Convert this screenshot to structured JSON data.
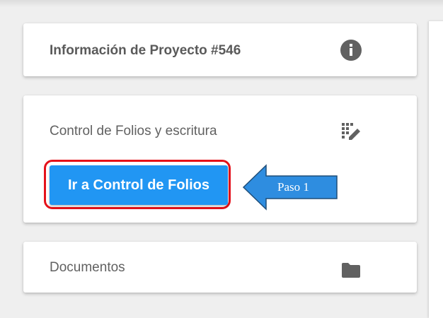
{
  "cards": {
    "info": {
      "title": "Información de Proyecto #546",
      "icon": "info-icon"
    },
    "folios": {
      "title": "Control de Folios y escritura",
      "icon": "folio-edit-icon",
      "button_label": "Ir a Control de Folios"
    },
    "documents": {
      "title": "Documentos",
      "icon": "folder-icon"
    }
  },
  "annotation": {
    "label": "Paso 1",
    "shape": "left-arrow-callout"
  },
  "colors": {
    "primary": "#2196f3",
    "highlight": "#e5111a",
    "callout_fill": "#2e8de0",
    "callout_border": "#1f4e79",
    "icon": "#616161"
  }
}
